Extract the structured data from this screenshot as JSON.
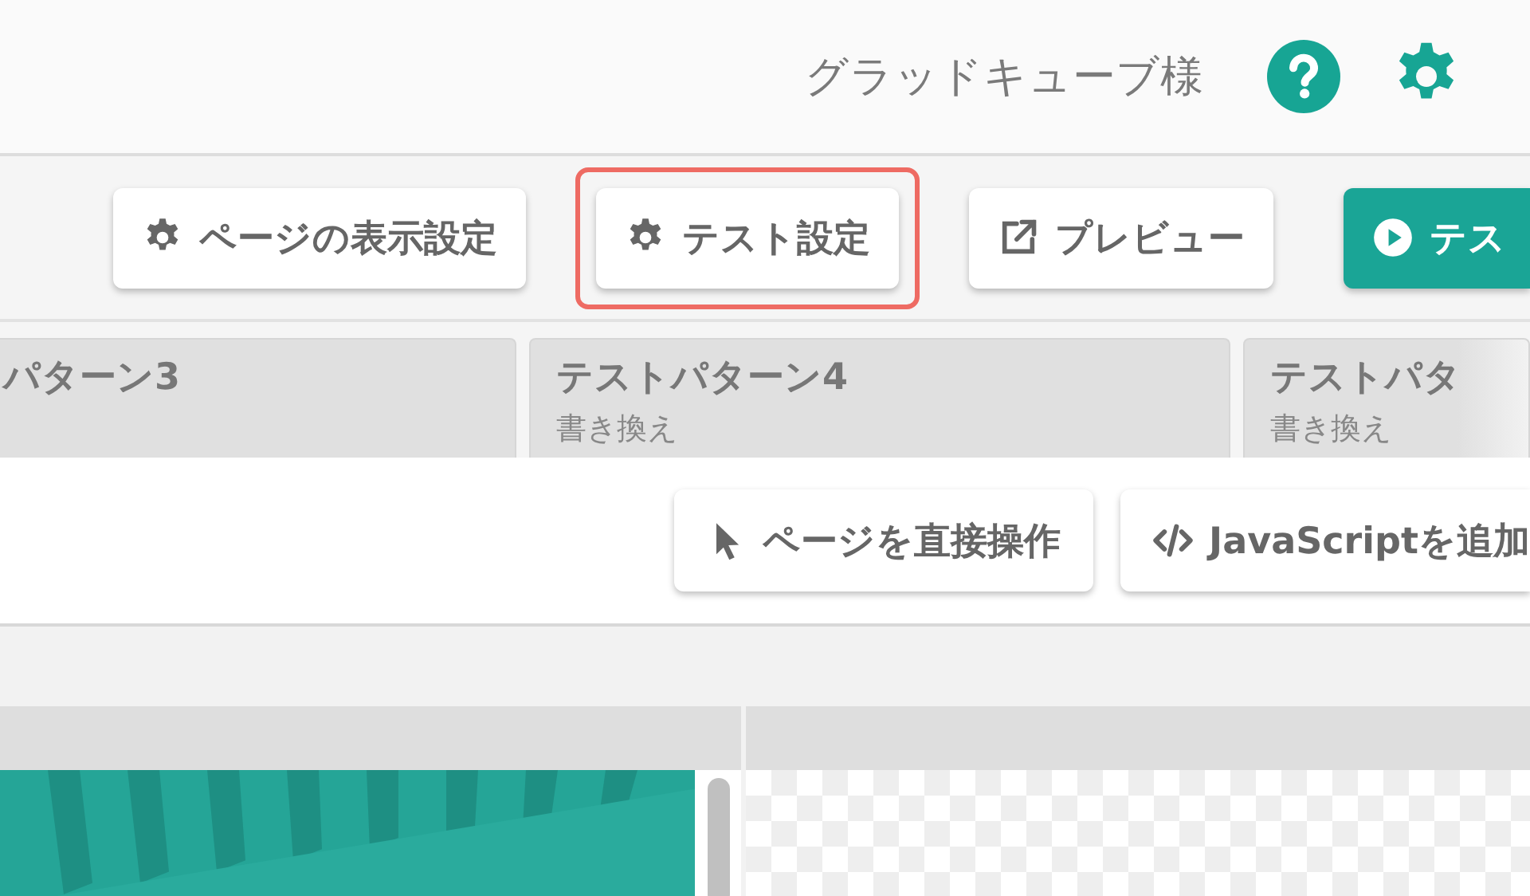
{
  "header": {
    "user_name": "グラッドキューブ様"
  },
  "toolbar": {
    "buttons": [
      {
        "kind": "gear",
        "label": "ページの表示設定",
        "highlighted": false,
        "primary": false
      },
      {
        "kind": "gear",
        "label": "テスト設定",
        "highlighted": true,
        "primary": false
      },
      {
        "kind": "external",
        "label": "プレビュー",
        "highlighted": false,
        "primary": false
      },
      {
        "kind": "play",
        "label": "テス",
        "highlighted": false,
        "primary": true
      }
    ]
  },
  "pattern_tabs": [
    {
      "title": "パターン3"
    },
    {
      "title": "テストパターン4",
      "subtitle": "書き換え"
    },
    {
      "title": "テストパタ",
      "subtitle": "書き換え"
    }
  ],
  "editor_actions": [
    {
      "kind": "pointer",
      "label": "ページを直接操作"
    },
    {
      "kind": "code",
      "label": "JavaScriptを追加"
    }
  ]
}
